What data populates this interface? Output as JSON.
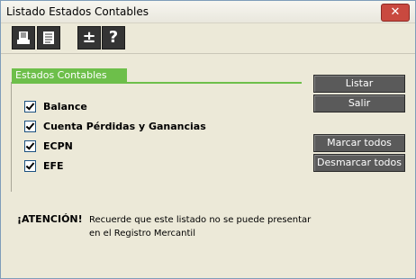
{
  "window": {
    "title": "Listado Estados Contables",
    "close": "✕"
  },
  "toolbar": {
    "help_label": "?",
    "plusminus_label": "±"
  },
  "group": {
    "title": "Estados Contables",
    "items": [
      {
        "label": "Balance",
        "checked": true
      },
      {
        "label": "Cuenta Pérdidas y Ganancias",
        "checked": true
      },
      {
        "label": "ECPN",
        "checked": true
      },
      {
        "label": "EFE",
        "checked": true
      }
    ]
  },
  "buttons": {
    "listar": "Listar",
    "salir": "Salir",
    "marcar_todos": "Marcar todos",
    "desmarcar_todos": "Desmarcar todos"
  },
  "notice": {
    "title": "¡ATENCIÓN!",
    "text": "Recuerde que este listado no se puede presentar en el Registro Mercantil"
  }
}
